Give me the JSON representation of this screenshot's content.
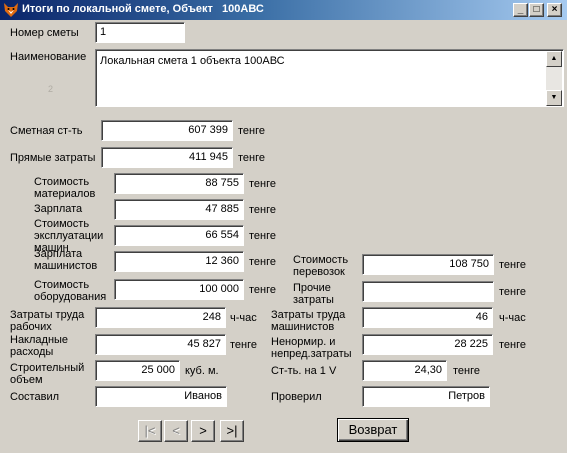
{
  "window": {
    "title": "Итоги по локальной смете, Объект   100АВС",
    "icon": "fox-head-icon",
    "minimize": "_",
    "maximize": "□",
    "close": "×"
  },
  "estimate": {
    "number_label": "Номер сметы",
    "number": "1",
    "name_label": "Наименование",
    "name": "Локальная смета 1 объекта 100АВС",
    "faint_mark": "2"
  },
  "costs": {
    "estimate_cost_label": "Сметная ст-ть",
    "estimate_cost": "607 399",
    "direct_label": "Прямые затраты",
    "direct": "411 945",
    "materials_label": "Стоимость материалов",
    "materials": "88 755",
    "salary_label": "Зарплата",
    "salary": "47 885",
    "machines_label": "Стоимость эксплуатации машин",
    "machines": "66 554",
    "machinist_salary_label": "Зарплата машинистов",
    "machinist_salary": "12 360",
    "equipment_label": "Стоимость оборудования",
    "equipment": "100 000",
    "transport_label": "Стоимость перевозок",
    "transport": "108 750",
    "other_label": "Прочие затраты",
    "other": "",
    "workers_labor_label": "Затраты  труда рабочих",
    "workers_labor": "248",
    "machinists_labor_label": "Затраты  труда машинистов",
    "machinists_labor": "46",
    "overhead_label": "Накладные расходы",
    "overhead": "45 827",
    "unforeseen_label": "Ненормир. и непред.затраты",
    "unforeseen": "28 225",
    "volume_label": "Строительный объем",
    "volume": "25 000",
    "cost_per_v_label": "Ст-ть. на 1 V",
    "cost_per_v": "24,30",
    "composer_label": "Составил",
    "composer": "Иванов",
    "checker_label": "Проверил",
    "checker": "Петров"
  },
  "units": {
    "currency": "тенге",
    "man_hour": "ч-час",
    "cubic_m": "куб. м."
  },
  "nav": {
    "first": "|<",
    "prev": "<",
    "next": ">",
    "last": ">|"
  },
  "return_label": "Возврат"
}
